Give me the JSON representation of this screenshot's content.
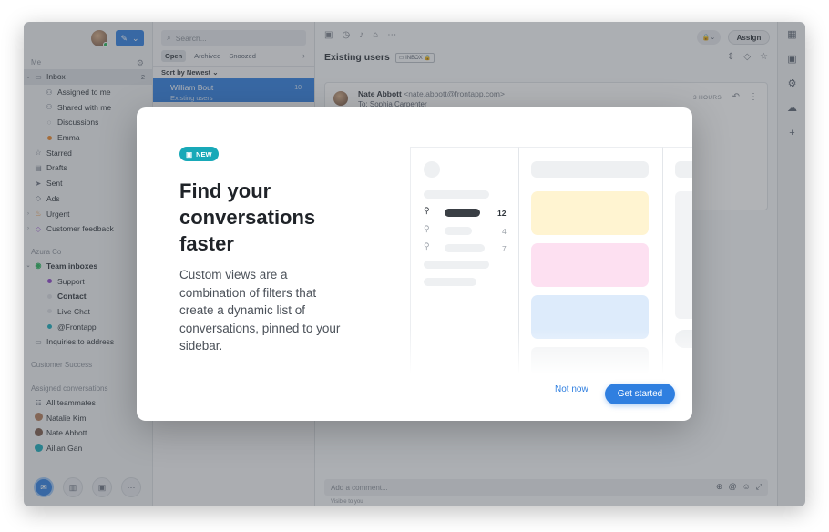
{
  "sidebar": {
    "me_label": "Me",
    "items": [
      {
        "label": "Inbox",
        "count": "2",
        "icon": "inbox-icon"
      },
      {
        "label": "Assigned to me",
        "icon": "assigned-icon"
      },
      {
        "label": "Shared with me",
        "icon": "shared-icon"
      },
      {
        "label": "Discussions",
        "icon": "discussion-icon"
      },
      {
        "label": "Emma",
        "icon": "dot-icon"
      },
      {
        "label": "Starred",
        "icon": "star-icon"
      },
      {
        "label": "Drafts",
        "icon": "draft-icon"
      },
      {
        "label": "Sent",
        "icon": "send-icon"
      },
      {
        "label": "Ads",
        "icon": "tag-icon"
      },
      {
        "label": "Urgent",
        "icon": "fire-icon"
      },
      {
        "label": "Customer feedback",
        "icon": "tag-icon"
      }
    ],
    "org_label": "Azura Co",
    "team_items": [
      {
        "label": "Team inboxes",
        "icon": "team-icon"
      },
      {
        "label": "Support",
        "icon": "dot-icon"
      },
      {
        "label": "Contact",
        "icon": "dot-icon"
      },
      {
        "label": "Live Chat",
        "icon": "dot-icon"
      },
      {
        "label": "@Frontapp",
        "icon": "dot-icon"
      },
      {
        "label": "Inquiries to address",
        "icon": "inbox-icon"
      }
    ],
    "customer_success_label": "Customer Success",
    "assigned_label": "Assigned conversations",
    "assigned_items": [
      {
        "label": "All teammates",
        "icon": "teammates-icon"
      },
      {
        "label": "Natalie Kim",
        "icon": "avatar"
      },
      {
        "label": "Nate Abbott",
        "icon": "avatar"
      },
      {
        "label": "Ailian Gan",
        "icon": "avatar"
      }
    ]
  },
  "list": {
    "search_placeholder": "Search...",
    "tabs": [
      "Open",
      "Archived",
      "Snoozed"
    ],
    "sort_label": "Sort by Newest ⌄",
    "conversation": {
      "name": "William Bout",
      "count": "10",
      "subject": "Existing users"
    }
  },
  "main": {
    "assign_label": "Assign",
    "subject": "Existing users",
    "inbox_badge": "INBOX",
    "message": {
      "from_name": "Nate Abbott",
      "from_email": "<nate.abbott@frontapp.com>",
      "to": "To: Sophia Carpenter",
      "time": "3 HOURS"
    },
    "comment_placeholder": "Add a comment...",
    "visible_note": "Visible to you"
  },
  "modal": {
    "badge": "NEW",
    "headline": "Find your conversations faster",
    "body": "Custom views are a combination of filters that create a dynamic list of conversations, pinned to your sidebar.",
    "not_now": "Not now",
    "get_started": "Get started",
    "illustration_counts": [
      "12",
      "4",
      "7"
    ]
  },
  "colors": {
    "accent": "#2f7fe0",
    "new_badge": "#18a9b8",
    "card_yellow": "#fff4d1",
    "card_pink": "#fde0f1",
    "card_blue": "#ddebfb"
  }
}
